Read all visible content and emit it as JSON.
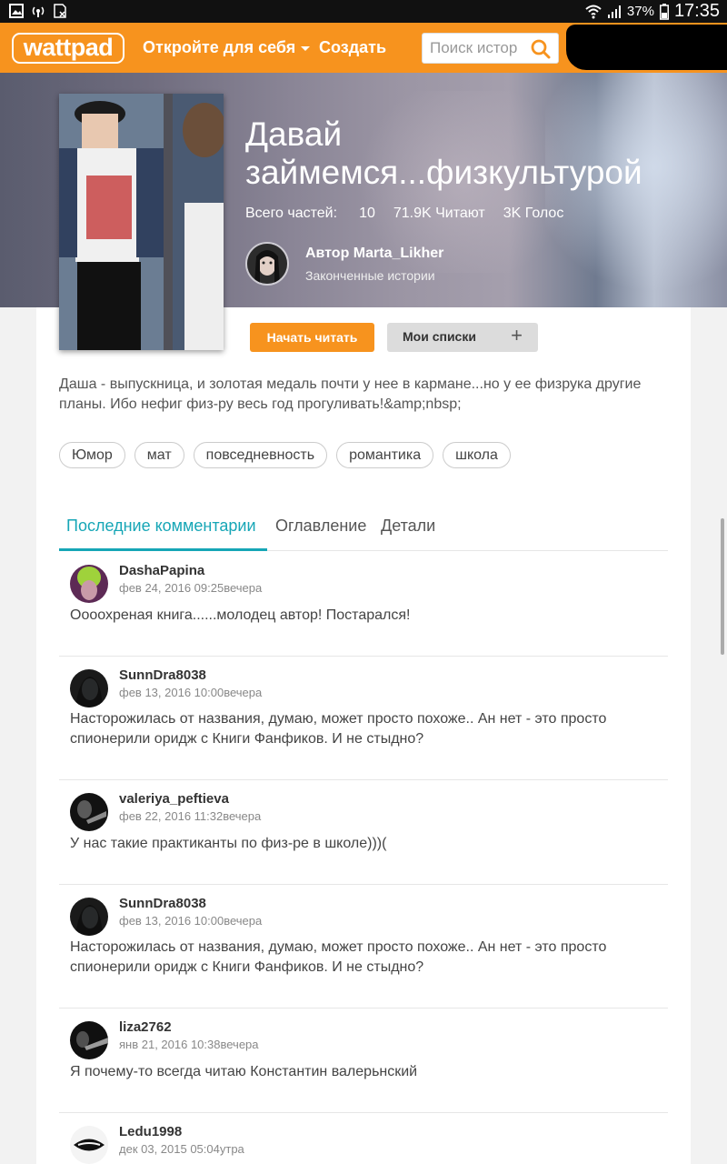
{
  "status_bar": {
    "battery": "37%",
    "time": "17:35"
  },
  "header": {
    "logo": "wattpad",
    "discover": "Откройте для себя",
    "create": "Создать",
    "search_placeholder": "Поиск истор"
  },
  "story": {
    "title": "Давай займемся...физкультурой",
    "parts_label": "Всего частей:",
    "parts_value": "10",
    "reads": "71.9K Читают",
    "votes": "3K Голос",
    "author_line": "Автор Marta_Likher",
    "author_status": "Законченные истории",
    "description": "Даша - выпускница, и золотая медаль почти у нее в кармане...но у ее физрука другие планы. Ибо нефиг физ-ру весь год прогуливать!&amp;nbsp;"
  },
  "actions": {
    "read": "Начать читать",
    "lists": "Мои списки",
    "lists_plus": "+"
  },
  "tags": [
    "Юмор",
    "мат",
    "повседневность",
    "романтика",
    "школа"
  ],
  "tabs": [
    "Последние комментарии",
    "Оглавление",
    "Детали"
  ],
  "comments": [
    {
      "user": "DashaPapina",
      "date": "фев 24, 2016 09:25вечера",
      "text": "Оооохреная книга......молодец автор!  Постарался!"
    },
    {
      "user": "SunnDra8038",
      "date": "фев 13, 2016 10:00вечера",
      "text": "Насторожилась от названия, думаю, может просто похоже.. Ан нет - это просто спионерили оридж с Книги Фанфиков. И не стыдно?"
    },
    {
      "user": "valeriya_peftieva",
      "date": "фев 22, 2016 11:32вечера",
      "text": "У нас такие практиканты по физ-ре в школе)))("
    },
    {
      "user": "SunnDra8038",
      "date": "фев 13, 2016 10:00вечера",
      "text": "Насторожилась от названия, думаю, может просто похоже.. Ан нет - это просто спионерили оридж с Книги Фанфиков. И не стыдно?"
    },
    {
      "user": "liza2762",
      "date": "янв 21, 2016 10:38вечера",
      "text": "Я почему-то всегда читаю Константин валерьнский"
    },
    {
      "user": "Ledu1998",
      "date": "дек 03, 2015 05:04утра",
      "text": ""
    }
  ],
  "colors": {
    "brand": "#f7931e",
    "tab_active": "#16a6b6"
  }
}
